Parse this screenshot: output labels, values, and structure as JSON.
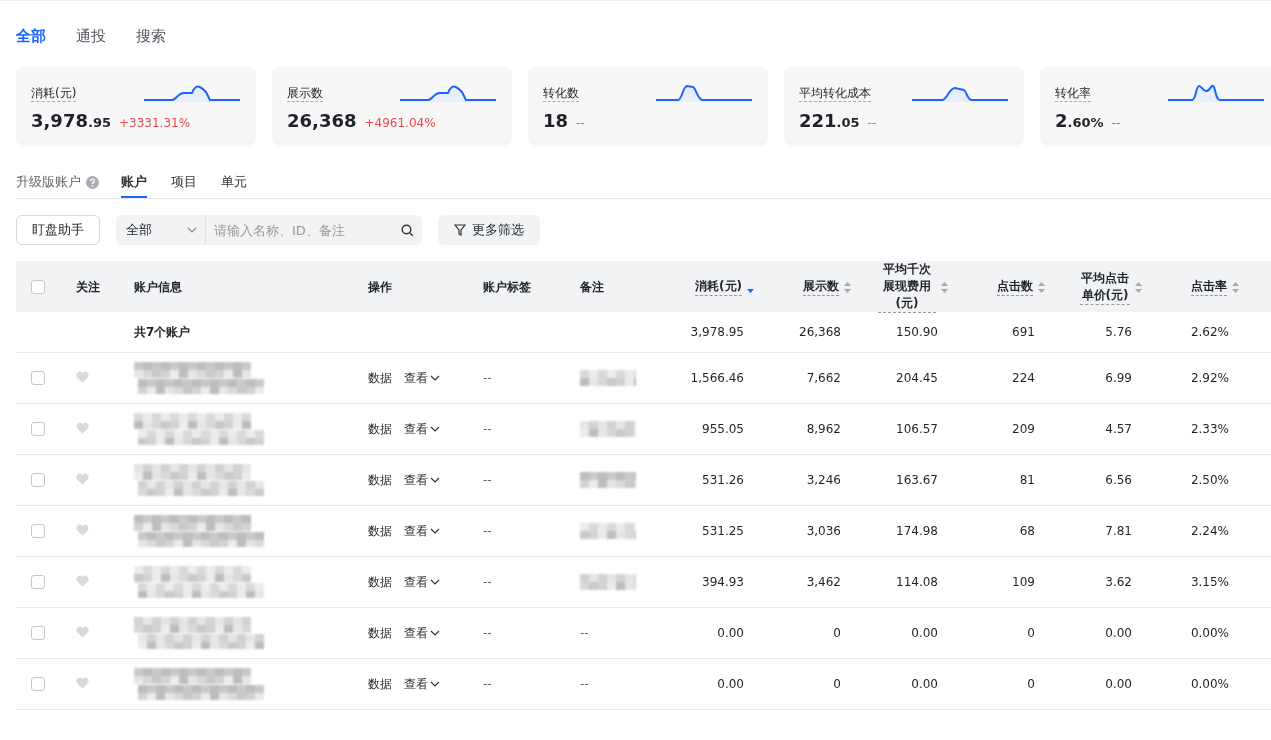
{
  "top_tabs": [
    {
      "label": "全部",
      "selected": true
    },
    {
      "label": "通投",
      "selected": false
    },
    {
      "label": "搜索",
      "selected": false
    }
  ],
  "metrics": [
    {
      "label": "消耗(元)",
      "value": "3,978",
      "decimal": ".95",
      "change": "+3331.31%",
      "color": "#e84a4a"
    },
    {
      "label": "展示数",
      "value": "26,368",
      "change": "+4961.04%",
      "color": "#e84a4a"
    },
    {
      "label": "转化数",
      "value": "18",
      "change": "--",
      "color": "#888888"
    },
    {
      "label": "平均转化成本",
      "value": "221",
      "decimal": ".05",
      "change": "--",
      "color": "#888888"
    },
    {
      "label": "转化率",
      "value": "2",
      "decimal": ".60%",
      "change": "--",
      "color": "#888888"
    }
  ],
  "level_tabs": {
    "label": "升级版账户",
    "tabs": [
      {
        "label": "账户",
        "selected": true
      },
      {
        "label": "项目",
        "selected": false
      },
      {
        "label": "单元",
        "selected": false
      }
    ]
  },
  "toolbar": {
    "assistant_button": "盯盘助手",
    "scope": "全部",
    "search_placeholder": "请输入名称、ID、备注",
    "filter_button": "更多筛选"
  },
  "table": {
    "all_checked": false,
    "columns": [
      {
        "label": "关注",
        "kind": "plain"
      },
      {
        "label": "账户信息",
        "kind": "plain"
      },
      {
        "label": "操作",
        "kind": "plain"
      },
      {
        "label": "账户标签",
        "kind": "plain"
      },
      {
        "label": "备注",
        "kind": "plain"
      },
      {
        "label": "消耗(元)",
        "kind": "metric",
        "sorted": true
      },
      {
        "label": "展示数",
        "kind": "metric",
        "sorted": false
      },
      {
        "label": "平均千次展现费用(元)",
        "kind": "metric",
        "sorted": false
      },
      {
        "label": "点击数",
        "kind": "metric",
        "sorted": false
      },
      {
        "label": "平均点击单价(元)",
        "kind": "metric",
        "sorted": false
      },
      {
        "label": "点击率",
        "kind": "metric",
        "sorted": false
      }
    ],
    "summary": {
      "label": "共7个账户",
      "values": [
        "3,978.95",
        "26,368",
        "150.90",
        "691",
        "5.76",
        "2.62%"
      ]
    },
    "rows": [
      {
        "checked": false,
        "followed": false,
        "actions": [
          "数据",
          "查看"
        ],
        "tag": "--",
        "note_hidden": true,
        "values": [
          "1,566.46",
          "7,662",
          "204.45",
          "224",
          "6.99",
          "2.92%"
        ]
      },
      {
        "checked": false,
        "followed": false,
        "actions": [
          "数据",
          "查看"
        ],
        "tag": "--",
        "note_hidden": true,
        "values": [
          "955.05",
          "8,962",
          "106.57",
          "209",
          "4.57",
          "2.33%"
        ]
      },
      {
        "checked": false,
        "followed": false,
        "actions": [
          "数据",
          "查看"
        ],
        "tag": "--",
        "note_hidden": true,
        "values": [
          "531.26",
          "3,246",
          "163.67",
          "81",
          "6.56",
          "2.50%"
        ]
      },
      {
        "checked": false,
        "followed": false,
        "actions": [
          "数据",
          "查看"
        ],
        "tag": "--",
        "note_hidden": true,
        "values": [
          "531.25",
          "3,036",
          "174.98",
          "68",
          "7.81",
          "2.24%"
        ]
      },
      {
        "checked": false,
        "followed": false,
        "actions": [
          "数据",
          "查看"
        ],
        "tag": "--",
        "note_hidden": true,
        "values": [
          "394.93",
          "3,462",
          "114.08",
          "109",
          "3.62",
          "3.15%"
        ]
      },
      {
        "checked": false,
        "followed": false,
        "actions": [
          "数据",
          "查看"
        ],
        "tag": "--",
        "note": "--",
        "note_hidden": false,
        "values": [
          "0.00",
          "0",
          "0.00",
          "0",
          "0.00",
          "0.00%"
        ]
      },
      {
        "checked": false,
        "followed": false,
        "actions": [
          "数据",
          "查看"
        ],
        "tag": "--",
        "note": "--",
        "note_hidden": false,
        "values": [
          "0.00",
          "0",
          "0.00",
          "0",
          "0.00",
          "0.00%"
        ]
      }
    ]
  }
}
